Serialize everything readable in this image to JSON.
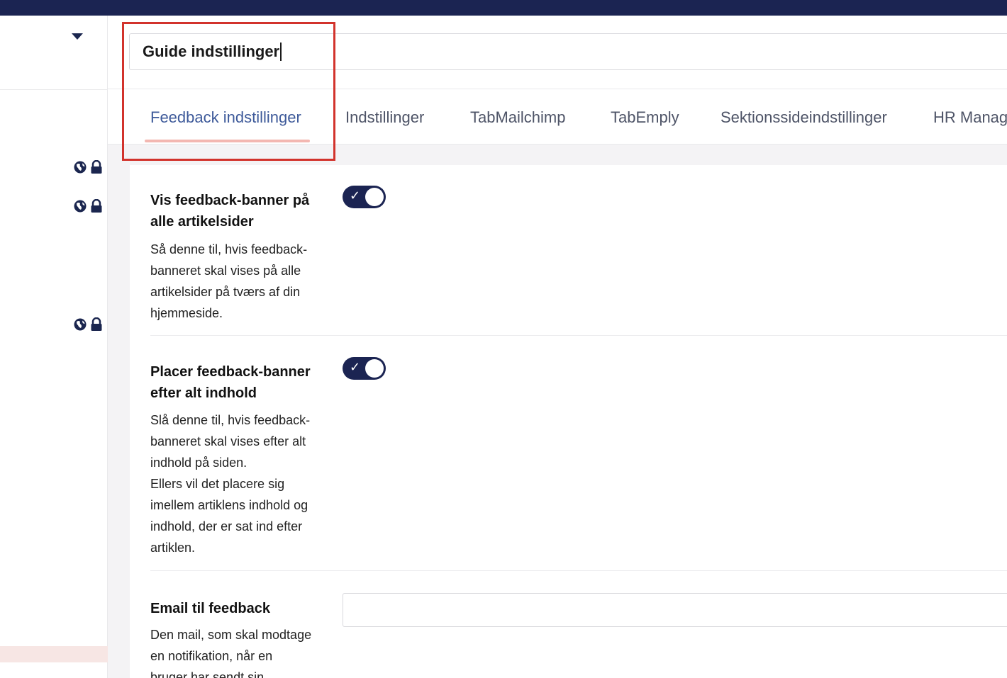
{
  "header": {
    "name_value": "Guide indstillinger"
  },
  "tabs": [
    {
      "label": "Feedback indstillinger",
      "active": true
    },
    {
      "label": "Indstillinger",
      "active": false
    },
    {
      "label": "TabMailchimp",
      "active": false
    },
    {
      "label": "TabEmply",
      "active": false
    },
    {
      "label": "Sektionssideindstillinger",
      "active": false
    },
    {
      "label": "HR Manag",
      "active": false
    }
  ],
  "properties": [
    {
      "label_lines": [
        "Vis feedback-banner på",
        "alle artikelsider"
      ],
      "desc_lines": [
        "Så denne til, hvis feedback-",
        "banneret skal vises på alle",
        "artikelsider på tværs af din",
        "hjemmeside."
      ],
      "control": "toggle",
      "toggle_on": true
    },
    {
      "label_lines": [
        "Placer feedback-banner",
        "efter alt indhold"
      ],
      "desc_lines": [
        "Slå denne til, hvis feedback-",
        "banneret skal vises efter alt",
        "indhold på siden.",
        "Ellers vil det placere sig",
        "imellem artiklens indhold og",
        "indhold, der er sat ind efter",
        "artiklen."
      ],
      "control": "toggle",
      "toggle_on": true
    },
    {
      "label_lines": [
        "Email til feedback"
      ],
      "desc_lines": [
        "Den mail, som skal modtage",
        "en notifikation, når en",
        "bruger har sendt sin"
      ],
      "control": "text-input",
      "value": ""
    }
  ],
  "icons": {
    "left_caret": "chevron-down-icon",
    "property_icons": [
      "globe-icon",
      "lock-icon"
    ],
    "toggle_check": "✓"
  },
  "colors": {
    "topbar": "#1b2452",
    "toggle_on": "#1b2452",
    "active_tab_text": "#3e5a9a",
    "active_tab_underline": "#f3b7b1",
    "highlight_box": "#d2332c",
    "content_bg": "#f4f3f5"
  }
}
